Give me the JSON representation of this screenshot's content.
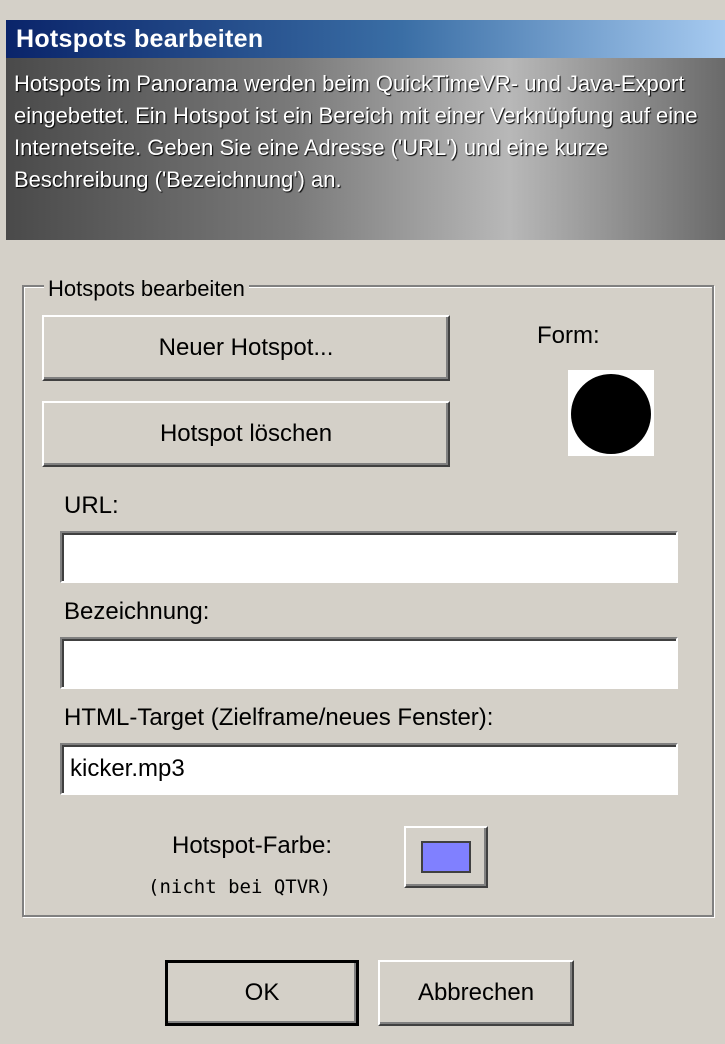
{
  "window": {
    "title": "Hotspots bearbeiten",
    "description": "Hotspots im Panorama werden beim QuickTimeVR- und Java-Export eingebettet. Ein Hotspot ist ein Bereich mit einer Verknüpfung auf eine Internetseite. Geben Sie eine Adresse ('URL') und eine kurze Beschreibung ('Bezeichnung') an."
  },
  "group": {
    "legend": "Hotspots bearbeiten",
    "new_hotspot_label": "Neuer Hotspot...",
    "delete_hotspot_label": "Hotspot löschen",
    "shape_label": "Form:",
    "shape_icon": "filled-circle",
    "shape_color": "#000000",
    "url_label": "URL:",
    "url_value": "",
    "name_label": "Bezeichnung:",
    "name_value": "",
    "target_label": "HTML-Target (Zielframe/neues Fenster):",
    "target_value": "kicker.mp3",
    "color_label": "Hotspot-Farbe:",
    "color_note": "(nicht bei QTVR)",
    "color_value": "#8080ff"
  },
  "footer": {
    "ok_label": "OK",
    "cancel_label": "Abbrechen"
  }
}
